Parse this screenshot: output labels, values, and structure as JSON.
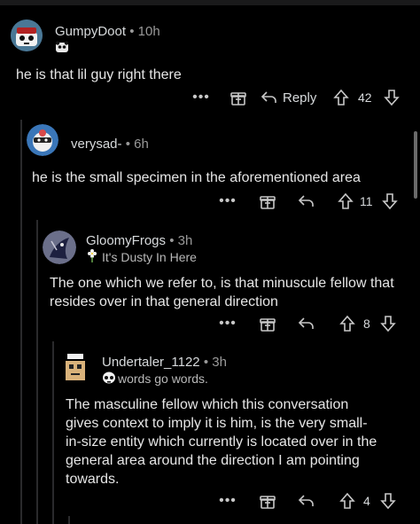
{
  "comments": [
    {
      "username": "GumpyDoot",
      "separator": "•",
      "age": "10h",
      "text": "he is that lil guy right there",
      "reply_label": "Reply",
      "votes": "42",
      "avatar_icon": "panda-avatar-icon",
      "flair_icon": "panda-face-icon"
    },
    {
      "username": "verysad-",
      "separator": "•",
      "age": "6h",
      "text": "he is the small specimen in the aforementioned area",
      "votes": "11",
      "avatar_icon": "ninja-avatar-icon"
    },
    {
      "username": "GloomyFrogs",
      "separator": "•",
      "age": "3h",
      "flair": "It's Dusty In Here",
      "text": "The one which we refer to, is that minuscule fellow that resides over in that general direction",
      "votes": "8",
      "avatar_icon": "dark-creature-avatar-icon",
      "flair_icon": "flower-icon"
    },
    {
      "username": "Undertaler_1122",
      "separator": "•",
      "age": "3h",
      "flair": "words go words.",
      "text": "The masculine fellow which this conversation gives context to imply it is him, is the very small-in-size entity which currently is located over in the general area around the direction I am pointing towards.",
      "votes": "4",
      "avatar_icon": "box-robot-avatar-icon",
      "flair_icon": "skull-icon"
    }
  ],
  "actions": {
    "more": "•••"
  },
  "colors": {
    "background": "#000000",
    "text": "#e6e6e6",
    "muted": "#9a9a9a",
    "line": "#2a2a2c"
  }
}
